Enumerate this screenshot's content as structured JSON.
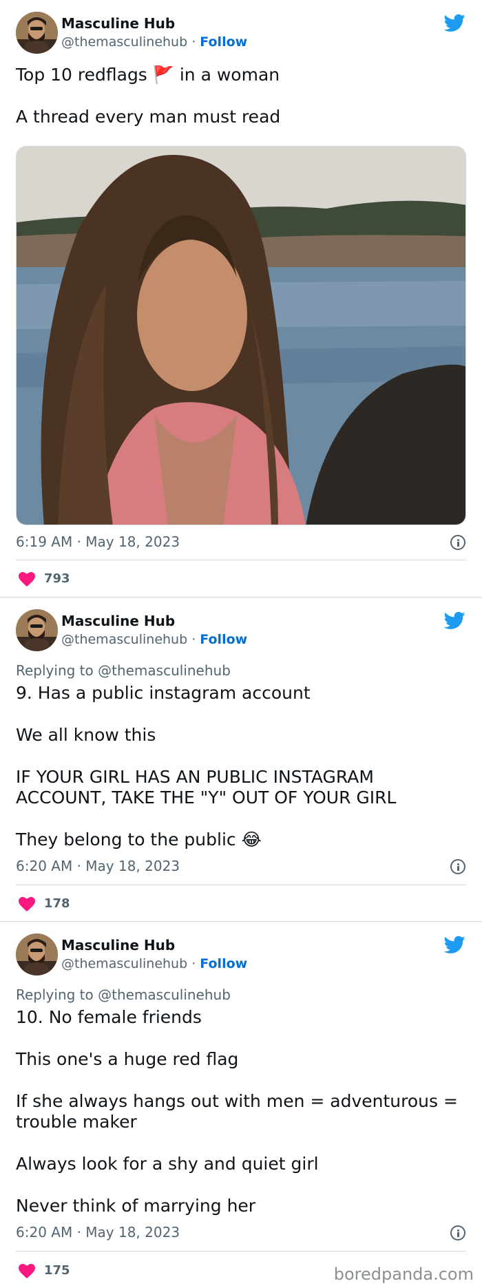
{
  "account": {
    "name": "Masculine Hub",
    "handle": "@themasculinehub",
    "separator": "·",
    "follow_label": "Follow"
  },
  "tweets": [
    {
      "text_lines": [
        "Top 10 redflags 🚩 in a woman",
        "",
        "A thread every man must read"
      ],
      "timestamp": "6:19 AM · May 18, 2023",
      "likes": "793"
    },
    {
      "reply_to": "Replying to @themasculinehub",
      "text_lines": [
        "9. Has a public instagram account",
        "",
        "We all know this",
        "",
        "IF YOUR GIRL HAS AN PUBLIC INSTAGRAM",
        "ACCOUNT, TAKE THE \"Y\" OUT OF YOUR GIRL",
        "",
        "They belong to the public 😂"
      ],
      "timestamp": "6:20 AM · May 18, 2023",
      "likes": "178"
    },
    {
      "reply_to": "Replying to @themasculinehub",
      "text_lines": [
        "10. No female friends",
        "",
        "This one's a huge red flag",
        "",
        "If she always hangs out with men = adventurous =",
        "trouble maker",
        "",
        "Always look for a shy and quiet girl",
        "",
        "Never think of marrying her"
      ],
      "timestamp": "6:20 AM · May 18, 2023",
      "likes": "175"
    }
  ],
  "watermark": "boredpanda.com",
  "colors": {
    "follow": "#006fd6",
    "twitter_blue": "#1d9bf0",
    "heart": "#f91880",
    "muted": "#536471"
  },
  "icons": {
    "logo": "twitter-bird-icon",
    "like": "heart-icon",
    "info": "info-icon"
  }
}
